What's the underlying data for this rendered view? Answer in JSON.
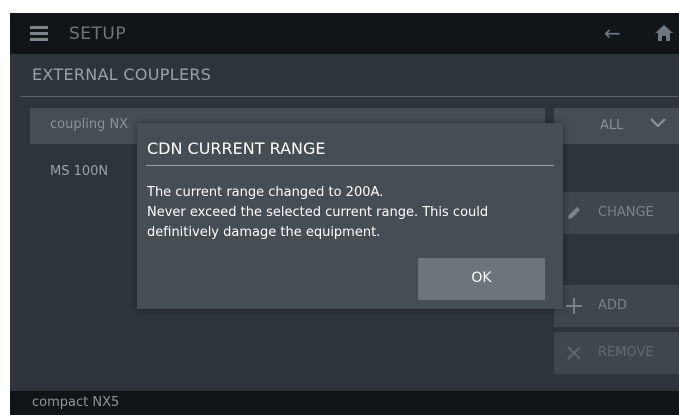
{
  "header": {
    "title": "SETUP",
    "menu_icon": "menu-icon",
    "back_icon": "arrow-left-icon",
    "home_icon": "home-icon"
  },
  "section": {
    "title": "EXTERNAL COUPLERS"
  },
  "coupling": {
    "label": "coupling NX"
  },
  "filter": {
    "selected": "ALL"
  },
  "list": {
    "items": [
      "MS 100N"
    ]
  },
  "buttons": {
    "change_label": "CHANGE",
    "add_label": "ADD",
    "remove_label": "REMOVE"
  },
  "footer": {
    "device": "compact NX5"
  },
  "dialog": {
    "title": "CDN CURRENT RANGE",
    "line1": "The current range changed to 200A.",
    "line2": "Never exceed the selected current range. This could definitively damage the equipment.",
    "ok_label": "OK"
  },
  "colors": {
    "background": "#2d343b",
    "bar": "#121518",
    "dialog": "#454d55",
    "ok_button": "#6d757c"
  }
}
